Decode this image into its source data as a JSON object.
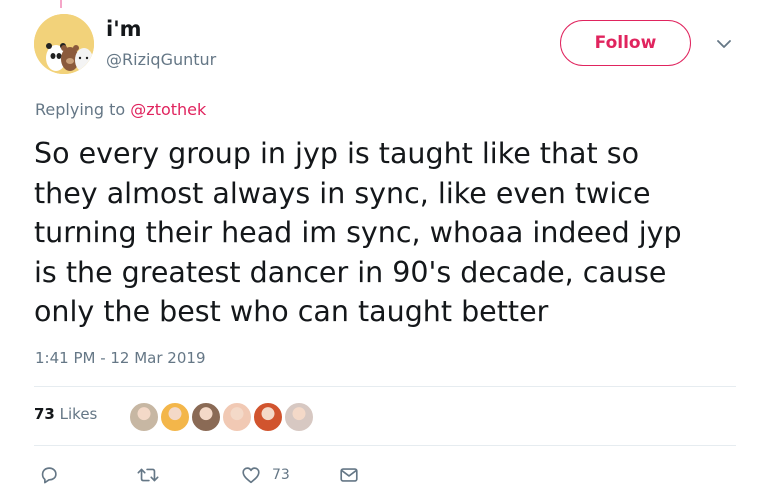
{
  "user": {
    "display_name": "i'm",
    "handle": "@RiziqGuntur",
    "avatar_icon": "bears-avatar-icon"
  },
  "follow_label": "Follow",
  "reply_context": {
    "prefix": "Replying to",
    "mention": "@ztothek"
  },
  "tweet": {
    "lines": [
      "So every group in jyp is taught like that so",
      "they almost always in sync, like even twice",
      "turning their head im sync, whoaa indeed jyp",
      "is the greatest dancer in 90's decade, cause",
      "only the best who can taught better"
    ],
    "timestamp": "1:41 PM - 12 Mar 2019"
  },
  "stats": {
    "likes_count": "73",
    "likes_label": "Likes",
    "liker_colors": [
      "#c7b7a3",
      "#f3b64a",
      "#8a6a55",
      "#f1c9b4",
      "#d1542e",
      "#d7c8c2"
    ]
  },
  "actions": {
    "like_count": "73"
  },
  "colors": {
    "accent": "#e0245e",
    "secondary_text": "#657786",
    "primary_text": "#14171a",
    "divider": "#e6ecf0"
  }
}
